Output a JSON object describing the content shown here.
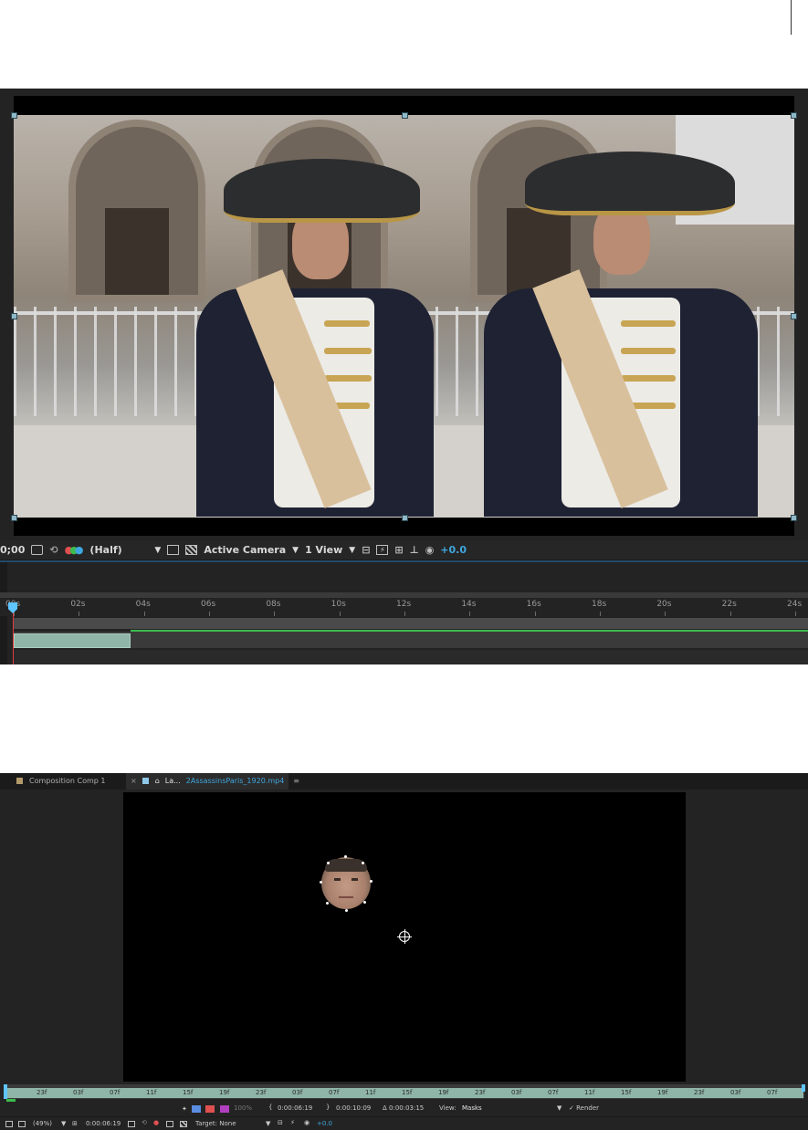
{
  "composition_viewer": {
    "toolbar": {
      "timecode": "0;00",
      "resolution": "(Half)",
      "camera": "Active Camera",
      "view_layout": "1 View",
      "exposure": "+0.0"
    },
    "timeline": {
      "ticks": [
        "00s",
        "02s",
        "04s",
        "06s",
        "08s",
        "10s",
        "12s",
        "14s",
        "16s",
        "18s",
        "20s",
        "22s",
        "24s"
      ]
    }
  },
  "layer_panel": {
    "tabs": {
      "composition": "Composition Comp 1",
      "close": "×",
      "layer_prefix": "La...",
      "layer_file": "2AssassinsParis_1920.mp4",
      "menu": "≡"
    },
    "ruler_ticks": [
      "23f",
      "03f",
      "07f",
      "11f",
      "15f",
      "19f",
      "23f",
      "03f",
      "07f",
      "11f",
      "15f",
      "19f",
      "23f",
      "03f",
      "07f",
      "11f",
      "15f",
      "19f",
      "23f",
      "03f",
      "07f"
    ],
    "status": {
      "opacity": "100%",
      "in_point": "0:00:06:19",
      "out_point": "0:00:10:09",
      "duration": "Δ 0:00:03:15",
      "view_label": "View:",
      "view_value": "Masks",
      "render_label": "✓ Render"
    },
    "bottom_toolbar": {
      "zoom": "(49%)",
      "timecode": "0:00:06:19",
      "target": "Target: None",
      "exposure": "+0.0"
    }
  },
  "colors": {
    "panel_bg": "#232323",
    "accent_blue": "#3fa7e0",
    "playhead_red": "#e23a3a",
    "work_area_green": "#3cbc4e",
    "clip_teal": "#8fb5a8"
  }
}
